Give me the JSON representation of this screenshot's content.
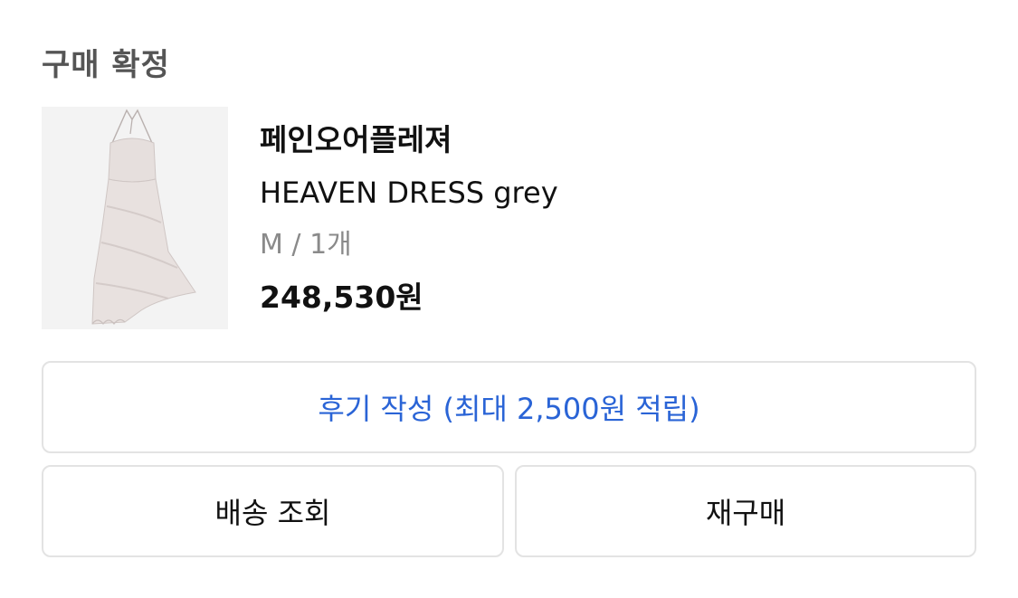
{
  "order": {
    "status": "구매 확정"
  },
  "product": {
    "brand": "페인오어플레져",
    "name": "HEAVEN DRESS grey",
    "option": "M / 1개",
    "price": "248,530원",
    "image_alt": "HEAVEN DRESS grey product photo",
    "colors": {
      "dress": "#e6dfdd",
      "dress_shadow": "#cfc6c4",
      "background": "#f3f3f3"
    }
  },
  "actions": {
    "review_label": "후기 작성 (최대 2,500원 적립)",
    "track_label": "배송 조회",
    "rebuy_label": "재구매",
    "colors": {
      "review_text": "#2a64d6",
      "border": "#e3e3e3"
    }
  }
}
